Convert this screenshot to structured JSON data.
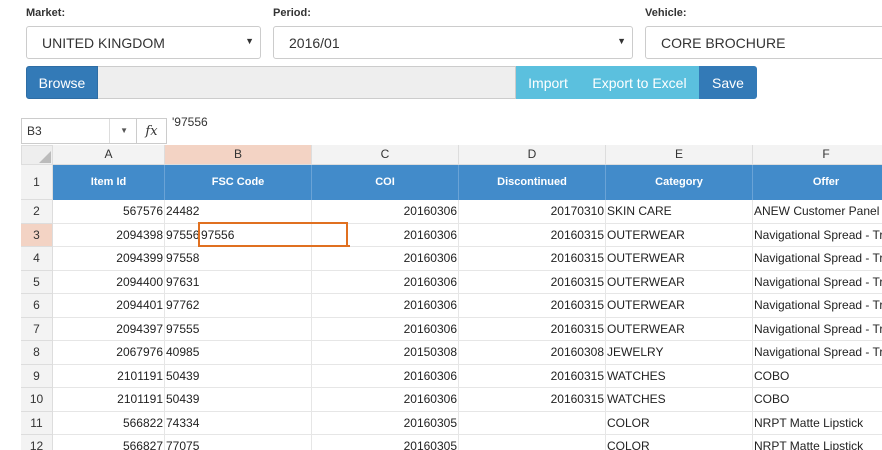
{
  "filters": {
    "market": {
      "label": "Market:",
      "value": "UNITED KINGDOM"
    },
    "period": {
      "label": "Period:",
      "value": "2016/01"
    },
    "vehicle": {
      "label": "Vehicle:",
      "value": "CORE BROCHURE"
    }
  },
  "toolbar": {
    "browse": "Browse",
    "import": "Import",
    "export": "Export to Excel",
    "save": "Save"
  },
  "formula_bar": {
    "name_box": "B3",
    "fx": "fx",
    "formula": "'97556"
  },
  "sheet": {
    "column_letters": [
      "A",
      "B",
      "C",
      "D",
      "E",
      "F"
    ],
    "header_row_number": "1",
    "headers": [
      "Item Id",
      "FSC Code",
      "COI",
      "Discontinued",
      "Category",
      "Offer"
    ],
    "selected_cell": "B3",
    "rows": [
      {
        "n": "2",
        "cells": [
          "567576",
          "24482",
          "20160306",
          "20170310",
          "SKIN CARE",
          "ANEW Customer Panel"
        ]
      },
      {
        "n": "3",
        "cells": [
          "2094398",
          "97556",
          "20160306",
          "20160315",
          "OUTERWEAR",
          "Navigational Spread - Tr"
        ],
        "editing": "97556"
      },
      {
        "n": "4",
        "cells": [
          "2094399",
          "97558",
          "20160306",
          "20160315",
          "OUTERWEAR",
          "Navigational Spread - Tr"
        ]
      },
      {
        "n": "5",
        "cells": [
          "2094400",
          "97631",
          "20160306",
          "20160315",
          "OUTERWEAR",
          "Navigational Spread - Tr"
        ]
      },
      {
        "n": "6",
        "cells": [
          "2094401",
          "97762",
          "20160306",
          "20160315",
          "OUTERWEAR",
          "Navigational Spread - Tr"
        ]
      },
      {
        "n": "7",
        "cells": [
          "2094397",
          "97555",
          "20160306",
          "20160315",
          "OUTERWEAR",
          "Navigational Spread - Tr"
        ]
      },
      {
        "n": "8",
        "cells": [
          "2067976",
          "40985",
          "20150308",
          "20160308",
          "JEWELRY",
          "Navigational Spread - Tr"
        ]
      },
      {
        "n": "9",
        "cells": [
          "2101191",
          "50439",
          "20160306",
          "20160315",
          "WATCHES",
          "COBO"
        ]
      },
      {
        "n": "10",
        "cells": [
          "2101191",
          "50439",
          "20160306",
          "20160315",
          "WATCHES",
          "COBO"
        ]
      },
      {
        "n": "11",
        "cells": [
          "566822",
          "74334",
          "20160305",
          "",
          "COLOR",
          "NRPT Matte Lipstick"
        ]
      },
      {
        "n": "12",
        "cells": [
          "566827",
          "77075",
          "20160305",
          "",
          "COLOR",
          "NRPT Matte Lipstick"
        ]
      }
    ]
  },
  "colors": {
    "primary": "#337ab7",
    "info": "#5bc0de",
    "header_blue": "#428bca",
    "selection": "#e07020"
  }
}
